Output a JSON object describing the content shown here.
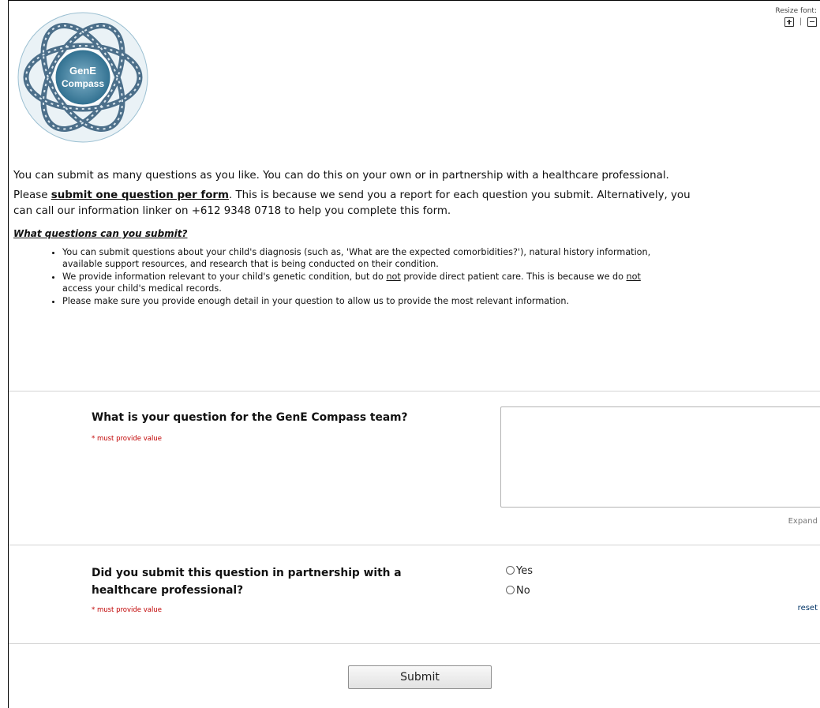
{
  "header": {
    "logo_text_line1": "GenE",
    "logo_text_line2": "Compass",
    "resize_label": "Resize font:",
    "resize_plus_icon": "plus-box-icon",
    "resize_minus_icon": "minus-box-icon",
    "resize_separator": "|"
  },
  "intro": {
    "p1": "You can submit as many questions as you like. You can do this on your own or in partnership with a healthcare professional.",
    "p2_prefix": "Please ",
    "p2_bold": "submit one question per form",
    "p2_line1_rest": ". This is because we send you a report for each question you submit. Alternatively, you",
    "p2_line2": "can call our information linker on +612 9348 0718 to help you complete this form.",
    "heading": "What questions can you submit?",
    "bullet1_line1": "You can submit questions about your child's diagnosis (such as, 'What are the expected comorbidities?'), natural history information,",
    "bullet1_line2": "available support resources, and research that is being conducted on their condition.",
    "bullet2_a": "We provide information relevant to your child's genetic condition, but do ",
    "bullet2_not1": "not",
    "bullet2_b": " provide direct patient care. This is because we do ",
    "bullet2_not2": "not",
    "bullet2_line2": "access your child's medical records.",
    "bullet3": "Please make sure you provide enough detail in your question to allow us to provide the most relevant information."
  },
  "form": {
    "q1": {
      "label": "What is your question for the GenE Compass team?",
      "required": "* must provide value",
      "value": "",
      "expand_label": "Expand"
    },
    "q2": {
      "label_line1": "Did you submit this question in partnership with a",
      "label_line2": "healthcare professional?",
      "required": "* must provide value",
      "options": [
        "Yes",
        "No"
      ],
      "reset_label": "reset"
    },
    "submit_label": "Submit"
  }
}
